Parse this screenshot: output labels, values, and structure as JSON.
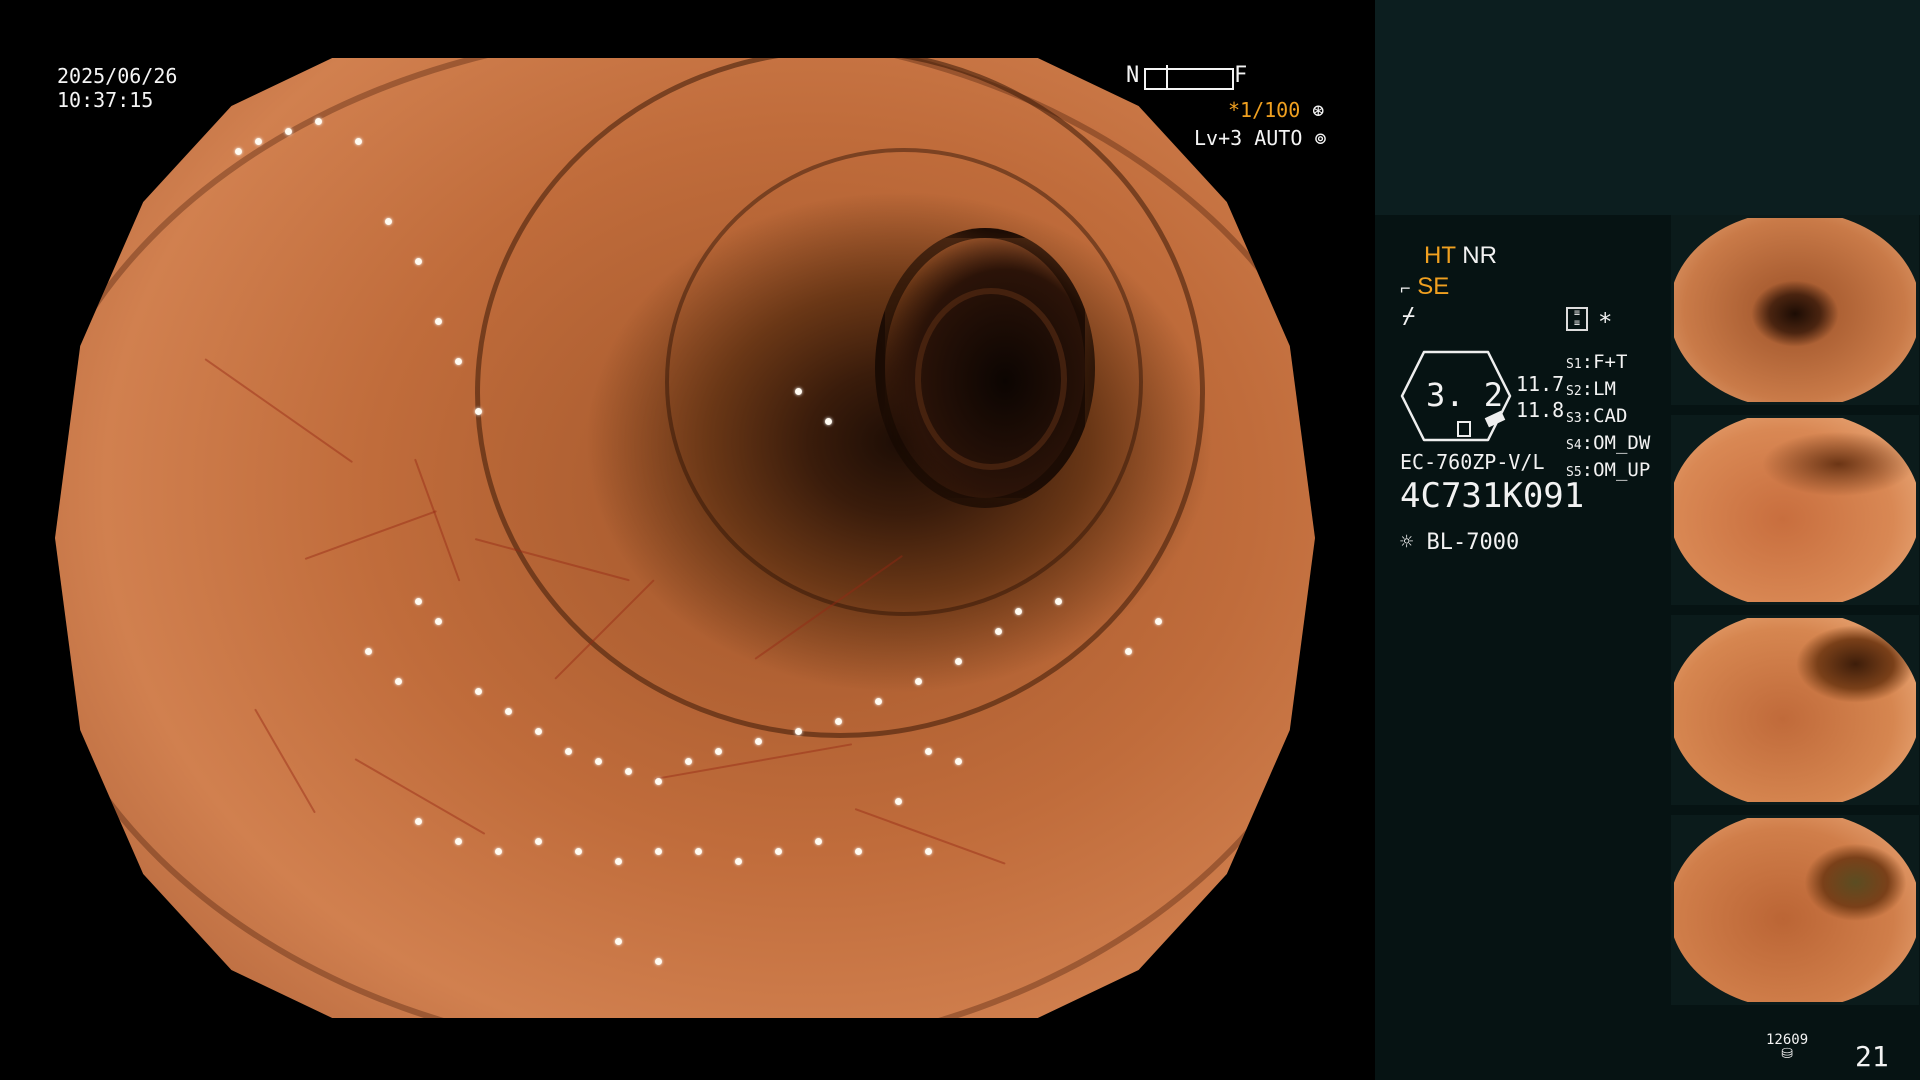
{
  "osd": {
    "date": "2025/06/26",
    "time": "10:37:15",
    "near_label": "N",
    "far_label": "F",
    "shutter": "*1/100",
    "shutter_icon": "aperture-icon",
    "level": "Lv+3",
    "mode": "AUTO",
    "mode_icon": "auto-iris-icon"
  },
  "panel": {
    "ht": "HT",
    "nr": "NR",
    "se": "SE",
    "se_icon": "structure-enhance-icon",
    "color_icon": "color-mode-icon",
    "screen_icon": "screen-layout-icon",
    "asterisk": "*",
    "gauge_value": "3. 2",
    "gauge_side_top": "11.7",
    "gauge_side_bottom": "11.8",
    "scope_model": "EC-760ZP-V/L",
    "serial": "4C731K091",
    "light_icon": "light-source-icon",
    "light_source": "BL-7000",
    "switches": [
      {
        "key": "S1",
        "value": "F+T"
      },
      {
        "key": "S2",
        "value": "LM"
      },
      {
        "key": "S3",
        "value": "CAD"
      },
      {
        "key": "S4",
        "value": "OM_DW"
      },
      {
        "key": "S5",
        "value": "OM_UP"
      }
    ],
    "storage_count": "12609",
    "storage_icon": "storage-icon",
    "image_count": "21"
  },
  "colors": {
    "accent_orange": "#f0a020",
    "panel_top": "#0c1e1f",
    "panel_body": "#061313"
  }
}
